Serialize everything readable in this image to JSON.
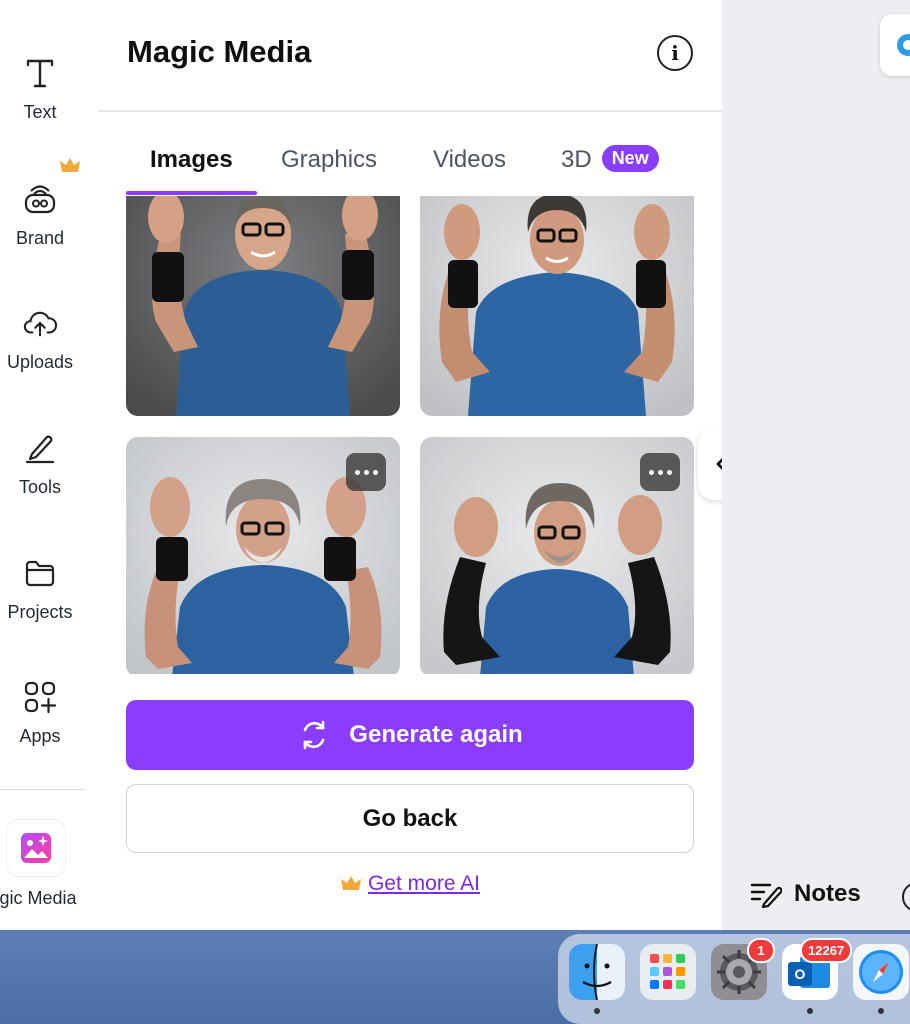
{
  "sidebar": {
    "items": [
      {
        "label": "Text",
        "icon": "text-icon"
      },
      {
        "label": "Brand",
        "icon": "brand-icon"
      },
      {
        "label": "Uploads",
        "icon": "upload-cloud-icon"
      },
      {
        "label": "Tools",
        "icon": "pen-tool-icon"
      },
      {
        "label": "Projects",
        "icon": "folder-icon"
      },
      {
        "label": "Apps",
        "icon": "apps-grid-icon"
      },
      {
        "label": "agic Media",
        "icon": "magic-media-icon"
      }
    ]
  },
  "panel": {
    "title": "Magic Media",
    "tabs": [
      {
        "label": "Images",
        "active": true
      },
      {
        "label": "Graphics",
        "active": false
      },
      {
        "label": "Videos",
        "active": false
      },
      {
        "label": "3D",
        "active": false,
        "badge": "New"
      }
    ],
    "images": [
      {
        "alt": "man in blue t-shirt with black wristbands raising hands, dark grey backdrop"
      },
      {
        "alt": "man in blue t-shirt with black wristbands raising hands, light grey backdrop"
      },
      {
        "alt": "man with curly grey hair in blue t-shirt raising hands"
      },
      {
        "alt": "man in blue t-shirt with black sleeves raising hands"
      }
    ],
    "more_options_icon": "more-horizontal-icon",
    "generate_label": "Generate again",
    "back_label": "Go back",
    "more_ai_label": "Get more AI"
  },
  "right": {
    "notes_label": "Notes"
  },
  "dock": {
    "apps": [
      {
        "name": "Finder"
      },
      {
        "name": "Launchpad"
      },
      {
        "name": "System Settings",
        "badge": "1"
      },
      {
        "name": "Outlook",
        "badge": "12267"
      },
      {
        "name": "Safari"
      }
    ]
  },
  "colors": {
    "accent": "#8b3dff",
    "link": "#7d2ae8",
    "crown": "#f2a93b"
  }
}
